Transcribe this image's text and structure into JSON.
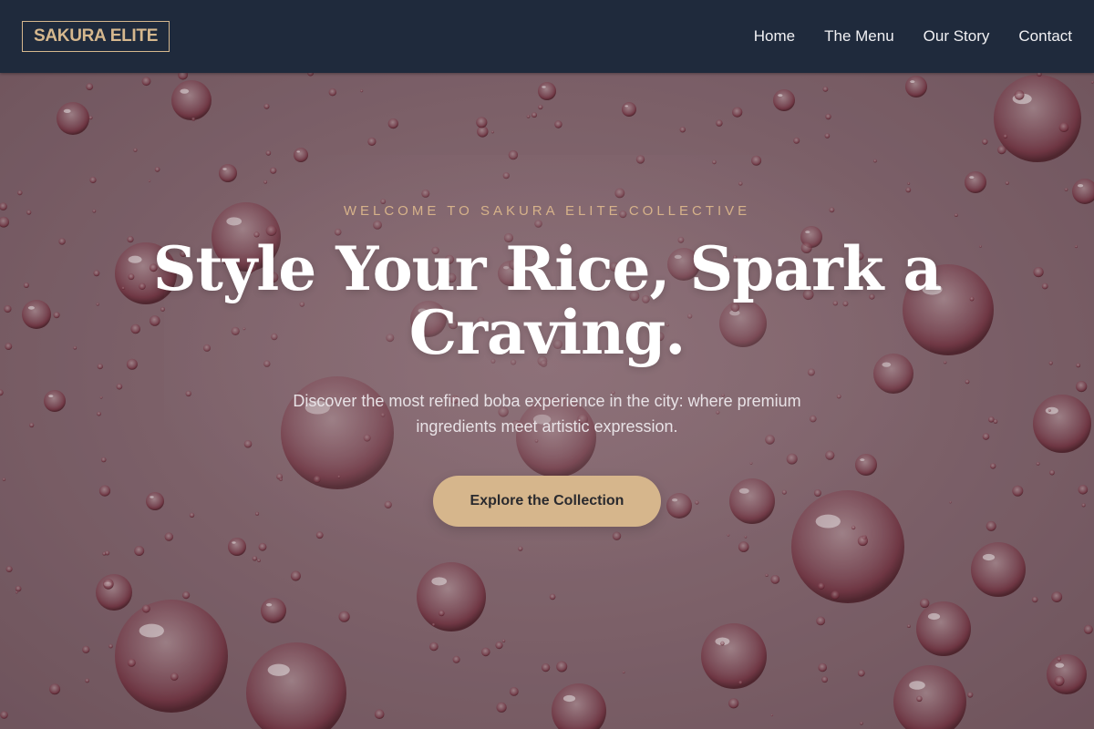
{
  "brand": {
    "name": "SAKURA ELITE"
  },
  "nav": {
    "items": [
      {
        "label": "Home"
      },
      {
        "label": "The Menu"
      },
      {
        "label": "Our Story"
      },
      {
        "label": "Contact"
      }
    ]
  },
  "hero": {
    "eyebrow": "WELCOME TO SAKURA ELITE COLLECTIVE",
    "headline": "Style Your Rice, Spark a Craving.",
    "subtext": "Discover the most refined boba experience in the city: where premium ingredients meet artistic expression.",
    "cta_label": "Explore the Collection"
  },
  "colors": {
    "nav_background": "#1f2a3c",
    "accent_gold": "#d6b68c",
    "hero_background": "#7d6068"
  }
}
